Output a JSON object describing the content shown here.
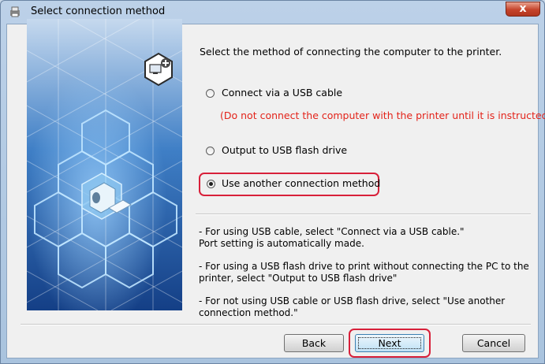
{
  "window": {
    "title": "Select connection method",
    "close_glyph": "x"
  },
  "main": {
    "heading": "Select the method of connecting the computer to the printer.",
    "options": [
      {
        "label": "Connect via a USB cable",
        "selected": false
      },
      {
        "label": "Output to USB flash drive",
        "selected": false
      },
      {
        "label": "Use another connection method",
        "selected": true
      }
    ],
    "warning": "(Do not connect the computer with the printer until it is instructed.)",
    "notes": [
      "- For using USB cable, select \"Connect via a USB cable.\"\nPort setting is automatically made.",
      "- For using a USB flash drive to print without connecting the PC to the printer, select \"Output to USB flash drive\"",
      "- For not using USB cable or USB flash drive, select \"Use another connection method.\""
    ]
  },
  "buttons": {
    "back": "Back",
    "next": "Next",
    "cancel": "Cancel"
  },
  "colors": {
    "warning": "#e3231a",
    "highlight": "#d8203a",
    "illustration_bg": "#1f5fa9"
  },
  "icons": [
    "window-app-icon",
    "computer-add-icon",
    "printer-icon"
  ]
}
